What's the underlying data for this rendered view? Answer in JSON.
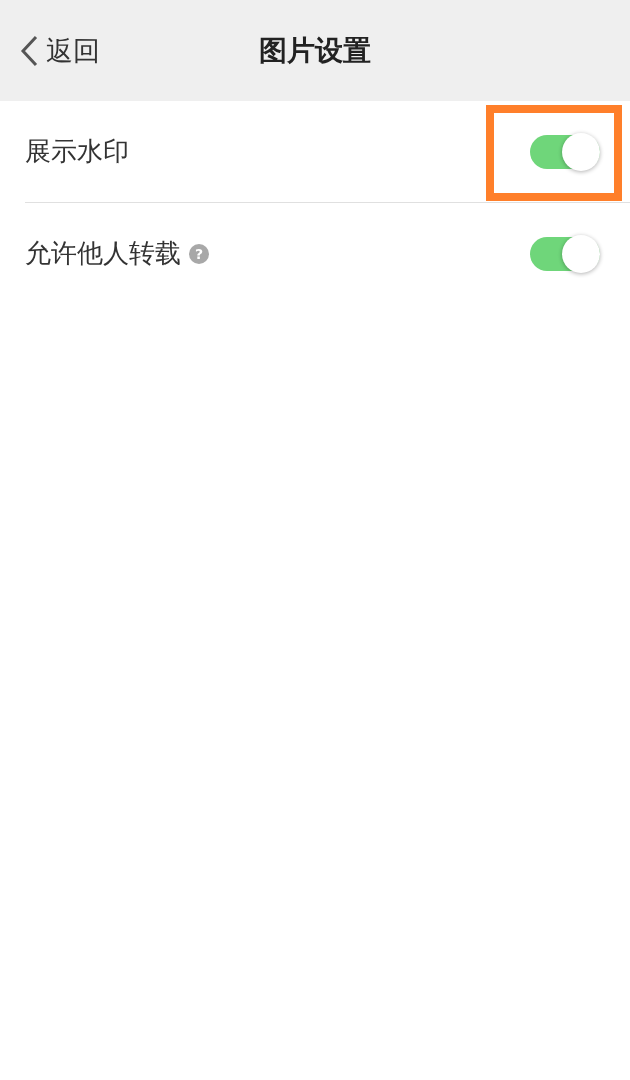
{
  "header": {
    "back_label": "返回",
    "title": "图片设置"
  },
  "rows": [
    {
      "label": "展示水印",
      "on": true,
      "highlighted": true
    },
    {
      "label": "允许他人转载",
      "hint": "?",
      "on": true,
      "highlighted": false
    }
  ]
}
